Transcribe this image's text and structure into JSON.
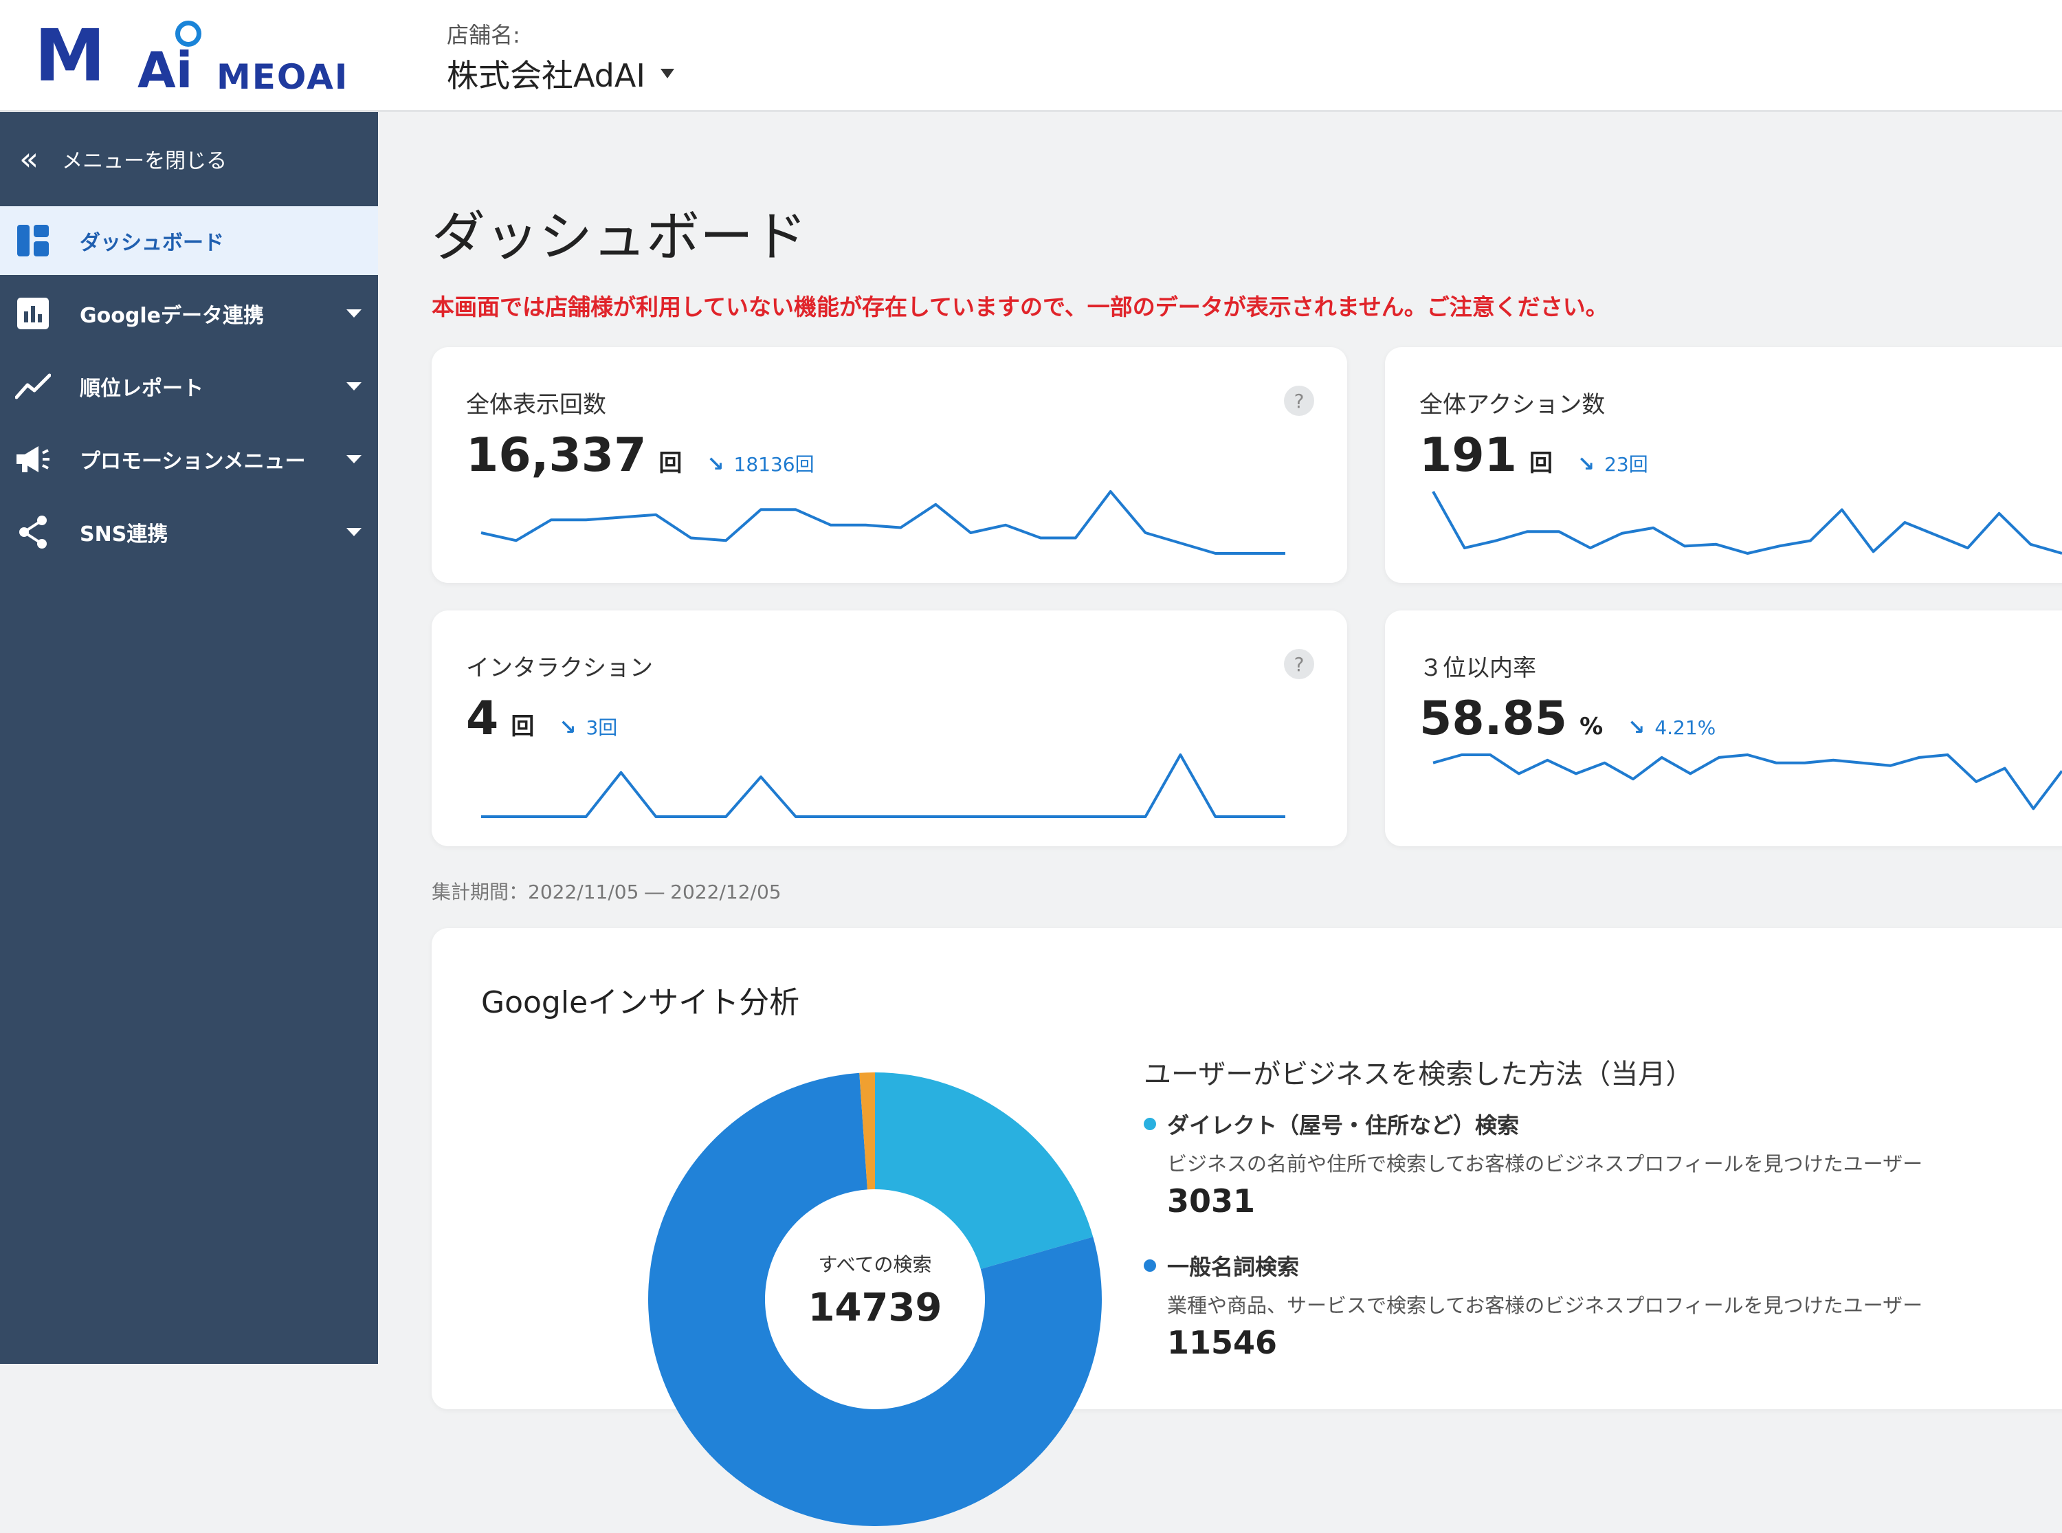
{
  "brand": {
    "logo_text": "MAi",
    "logo_sub": "MEOAI"
  },
  "store": {
    "label": "店舗名:",
    "name": "株式会社AdAI"
  },
  "sidebar": {
    "close_label": "メニューを閉じる",
    "items": [
      {
        "label": "ダッシュボード",
        "icon": "dashboard-icon",
        "active": true
      },
      {
        "label": "Googleデータ連携",
        "icon": "bar-chart-icon",
        "active": false
      },
      {
        "label": "順位レポート",
        "icon": "trend-line-icon",
        "active": false
      },
      {
        "label": "プロモーションメニュー",
        "icon": "megaphone-icon",
        "active": false
      },
      {
        "label": "SNS連携",
        "icon": "share-icon",
        "active": false
      }
    ]
  },
  "main": {
    "title": "ダッシュボード",
    "notice": "本画面では店舗様が利用していない機能が存在していますので、一部のデータが表示されません。ご注意ください。",
    "help_glyph": "?",
    "trend_arrow": "↘",
    "cards": [
      {
        "label": "全体表示回数",
        "value": "16,337",
        "unit": "回",
        "prev": "18136回"
      },
      {
        "label": "全体アクション数",
        "value": "191",
        "unit": "回",
        "prev": "23回"
      },
      {
        "label": "インタラクション",
        "value": "4",
        "unit": "回",
        "prev": "3回"
      },
      {
        "label": "３位以内率",
        "value": "58.85",
        "unit": "%",
        "prev": "4.21%"
      }
    ],
    "period": "集計期間：2022/11/05 ― 2022/12/05",
    "insight": {
      "title": "Googleインサイト分析",
      "method_title": "ユーザーがビジネスを検索した方法（当月）",
      "center_label": "すべての検索",
      "center_value": "14739",
      "methods": [
        {
          "name": "ダイレクト（屋号・住所など）検索",
          "desc": "ビジネスの名前や住所で検索してお客様のビジネスプロフィールを見つけたユーザー",
          "count": "3031",
          "color": "#29b0e0"
        },
        {
          "name": "一般名詞検索",
          "desc": "業種や商品、サービスで検索してお客様のビジネスプロフィールを見つけたユーザー",
          "count": "11546",
          "color": "#2182d8"
        }
      ]
    }
  },
  "colors": {
    "sidebar_bg": "#354a64",
    "accent": "#1f7bd0",
    "notice": "#e0242a",
    "donut_direct": "#29b0e0",
    "donut_general": "#2182d8",
    "donut_other": "#f0a030"
  },
  "sparklines": [
    [
      8,
      5,
      13,
      13,
      14,
      15,
      6,
      5,
      17,
      17,
      11,
      11,
      10,
      19,
      8,
      11,
      6,
      6,
      24,
      8,
      4,
      0,
      0,
      0
    ],
    [
      34,
      3,
      7,
      12,
      12,
      3,
      11,
      14,
      4,
      5,
      0,
      4,
      7,
      24,
      1,
      17,
      10,
      3,
      22,
      5,
      0
    ],
    [
      0,
      0,
      0,
      0,
      20,
      0,
      0,
      0,
      18,
      0,
      0,
      0,
      0,
      0,
      0,
      0,
      0,
      0,
      0,
      0,
      28,
      0,
      0,
      0
    ],
    [
      20,
      23,
      23,
      16,
      21,
      16,
      20,
      14,
      22,
      16,
      22,
      23,
      20,
      20,
      21,
      20,
      19,
      22,
      23,
      13,
      18,
      3,
      17
    ]
  ],
  "donut_shares": {
    "direct": 3031,
    "general": 11546,
    "other": 162
  }
}
